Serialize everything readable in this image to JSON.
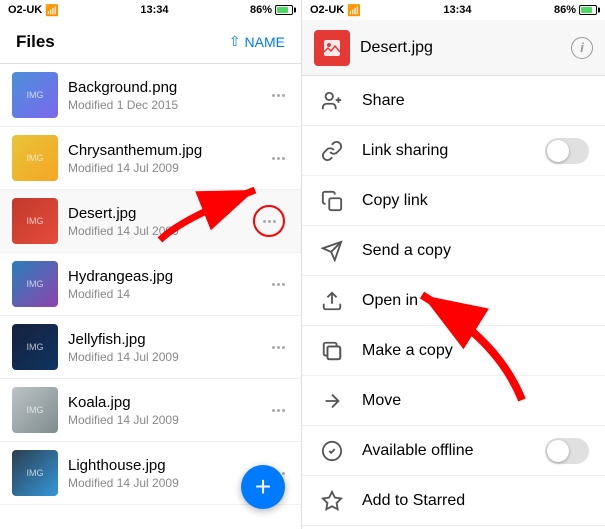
{
  "left": {
    "status": {
      "carrier": "O2-UK",
      "time": "13:34",
      "battery": "86%"
    },
    "nav": {
      "title": "Files",
      "sort": "NAME"
    },
    "files": [
      {
        "name": "Background.png",
        "date": "Modified 1 Dec 2015",
        "thumb": "bg"
      },
      {
        "name": "Chrysanthemum.jpg",
        "date": "Modified 14 Jul 2009",
        "thumb": "flower"
      },
      {
        "name": "Desert.jpg",
        "date": "Modified 14 Jul 2009",
        "thumb": "desert",
        "highlighted": true
      },
      {
        "name": "Hydrangeas.jpg",
        "date": "Modified 14",
        "thumb": "hydrangeas"
      },
      {
        "name": "Jellyfish.jpg",
        "date": "Modified 14 Jul 2009",
        "thumb": "jellyfish"
      },
      {
        "name": "Koala.jpg",
        "date": "Modified 14 Jul 2009",
        "thumb": "koala"
      },
      {
        "name": "Lighthouse.jpg",
        "date": "Modified 14 Jul 2009",
        "thumb": "lighthouse"
      }
    ],
    "fab_label": "+"
  },
  "right": {
    "status": {
      "carrier": "O2-UK",
      "time": "13:34",
      "battery": "86%"
    },
    "header": {
      "filename": "Desert.jpg"
    },
    "menu_items": [
      {
        "id": "share",
        "label": "Share",
        "icon": "person-add",
        "has_toggle": false
      },
      {
        "id": "link-sharing",
        "label": "Link sharing",
        "icon": "link",
        "has_toggle": true
      },
      {
        "id": "copy-link",
        "label": "Copy link",
        "icon": "copy-link",
        "has_toggle": false
      },
      {
        "id": "send-copy",
        "label": "Send a copy",
        "icon": "send",
        "has_toggle": false
      },
      {
        "id": "open-in",
        "label": "Open in",
        "icon": "open-in",
        "has_toggle": false
      },
      {
        "id": "make-copy",
        "label": "Make a copy",
        "icon": "make-copy",
        "has_toggle": false
      },
      {
        "id": "move",
        "label": "Move",
        "icon": "move",
        "has_toggle": false
      },
      {
        "id": "available-offline",
        "label": "Available offline",
        "icon": "checkmark",
        "has_toggle": true
      },
      {
        "id": "add-starred",
        "label": "Add to Starred",
        "icon": "star",
        "has_toggle": false
      }
    ]
  }
}
